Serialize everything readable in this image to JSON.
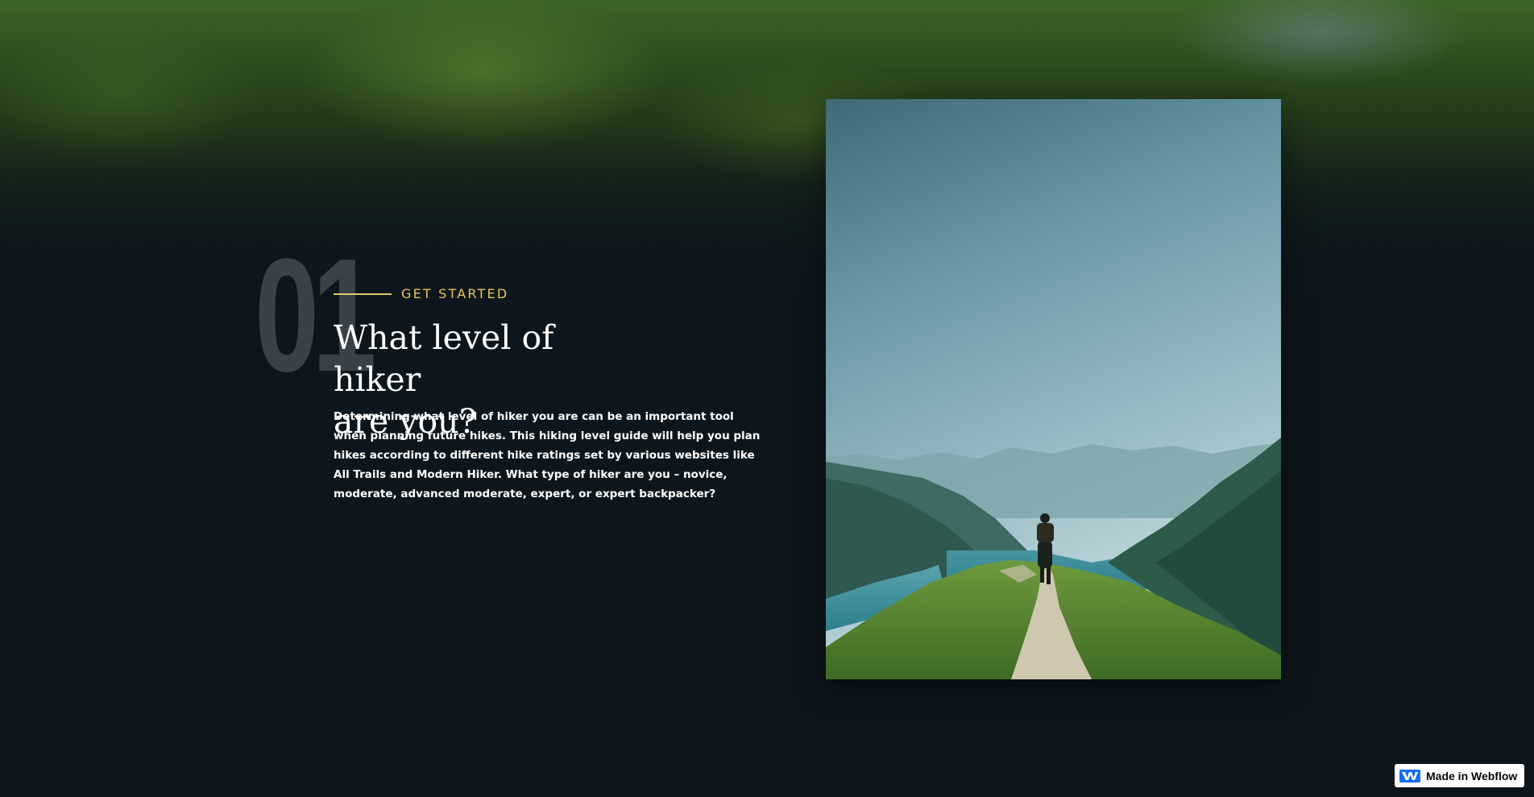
{
  "section": {
    "number": "01",
    "eyebrow": "GET STARTED",
    "title": "What level of  hiker\nare you?",
    "body": "Determining what level of hiker you are can be an important tool when planning future hikes. This hiking level guide will help you plan hikes according to different hike ratings set by various websites like All Trails and Modern Hiker. What type of hiker are you – novice, moderate, advanced moderate, expert, or expert backpacker?"
  },
  "badge": {
    "label": "Made in Webflow",
    "icon": "webflow-logo-icon"
  },
  "colors": {
    "background": "#0d161c",
    "accent": "#e6c65e",
    "text": "#ffffff",
    "badge_logo": "#146ef5"
  }
}
